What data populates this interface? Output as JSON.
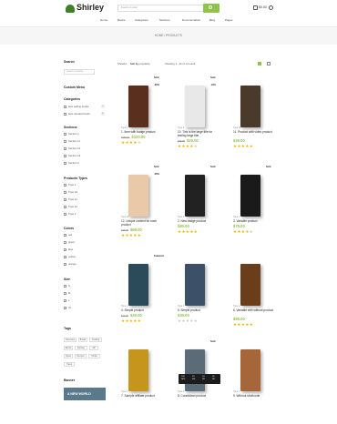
{
  "header": {
    "logo": "Shirley",
    "search_placeholder": "Search an order",
    "cart_total": "$0.00",
    "nav": [
      "Home",
      "Books",
      "Categories",
      "Sections",
      "Documentation",
      "Blog",
      "Pages"
    ]
  },
  "breadcrumb": "HOME / PRODUCTS",
  "sidebar": {
    "search_title": "Search",
    "search_placeholder": "Search products",
    "menu_title": "Custom Menu",
    "categories_title": "Categories",
    "categories": [
      {
        "label": "best selling books",
        "count": "2"
      },
      {
        "label": "best tranded books",
        "count": "6"
      }
    ],
    "sections_title": "Sections",
    "sections": [
      "Section 1",
      "Section 11",
      "Section 12",
      "Section 13",
      "Section 2"
    ],
    "types_title": "Products Types",
    "types": [
      "Type 1",
      "Type 10",
      "Type 11",
      "Type 12",
      "Type 2"
    ],
    "colors_title": "Colors",
    "colors": [
      "red",
      "green",
      "blue",
      "yellow",
      "orange"
    ],
    "sizes_title": "Size",
    "sizes": [
      "S",
      "M",
      "L",
      "XL"
    ],
    "tags_title": "Tags",
    "tags": [
      "Adventure",
      "Books",
      "Cooking",
      "Ebook",
      "Fantasy",
      "Gift",
      "Novel",
      "Recipes",
      "Thriller",
      "Travel"
    ],
    "banner_label": "Banner",
    "banner_text": "A NEW WORLD"
  },
  "toolbar": {
    "show": "Show",
    "show_value": "12",
    "sort": "Sort by",
    "sort_value": "Sort by popularity",
    "showing": "Showing 1 - 12 of 14 result"
  },
  "products": [
    {
      "tag": "Sold",
      "pct": "-30%",
      "cat": "Type 1",
      "title": "1. Item with badge product",
      "old": "$150.00",
      "price": "$120.00",
      "rating": 4,
      "color": "#5a2f1e"
    },
    {
      "tag": "Sold",
      "pct": "-10%",
      "cat": "Type 1",
      "title": "10. This is the large title for testing large title",
      "old": "$30.00",
      "price": "$29.00",
      "rating": 4,
      "color": "#e8e8e8"
    },
    {
      "tag": "",
      "pct": "",
      "cat": "Type 10",
      "title": "11. Product with video product",
      "old": "",
      "price": "$29.00",
      "rating": 5,
      "color": "#4a3a2c"
    },
    {
      "tag": "Sold",
      "pct": "-30%",
      "cat": "Type 12",
      "title": "12. Unique content for each product",
      "old": "$40.00",
      "price": "$99.00",
      "rating": 5,
      "color": "#e9c9a8"
    },
    {
      "tag": "Sold",
      "pct": "",
      "cat": "Type 1",
      "title": "2. New badge product",
      "old": "",
      "price": "$80.00",
      "rating": 5,
      "color": "#222222"
    },
    {
      "tag": "Sold",
      "pct": "",
      "cat": "Type 1",
      "title": "3. Variable product",
      "old": "",
      "price": "$75.00",
      "rating": 4,
      "color": "#1a1a1a"
    },
    {
      "tag": "Featured",
      "pct": "",
      "cat": "Type 1",
      "title": "4. Simple product",
      "old": "$40.00",
      "price": "$30.00",
      "rating": 5,
      "color": "#2b4a5a"
    },
    {
      "tag": "",
      "pct": "",
      "cat": "Type 1",
      "title": "5. Simple product",
      "old": "",
      "price": "$30.00",
      "rating": 0,
      "color": "#3c5068"
    },
    {
      "tag": "",
      "pct": "",
      "cat": "Type 1",
      "title": "6. Variable with without product",
      "old": "",
      "price": "$50.00",
      "rating": 5,
      "color": "#6a3e1a"
    },
    {
      "tag": "",
      "pct": "",
      "cat": "Type 1",
      "title": "7. Sample affiliate product",
      "old": "",
      "price": "",
      "rating": 0,
      "color": "#c6961c"
    },
    {
      "tag": "Sold",
      "pct": "",
      "cat": "Type 1",
      "title": "8. Countdown product",
      "old": "",
      "price": "",
      "rating": 0,
      "color": "#5c6b78"
    },
    {
      "tag": "",
      "pct": "",
      "cat": "Type 1",
      "title": "9. Without shortcode",
      "old": "",
      "price": "",
      "rating": 0,
      "color": "#a5663a"
    }
  ],
  "countdown": {
    "labels": [
      "158",
      "23",
      "14",
      "28"
    ],
    "units": [
      "DAYS",
      "HRS",
      "MIN",
      "SEC"
    ]
  },
  "colors": {
    "accent": "#8fc34a",
    "star": "#f5b300"
  }
}
